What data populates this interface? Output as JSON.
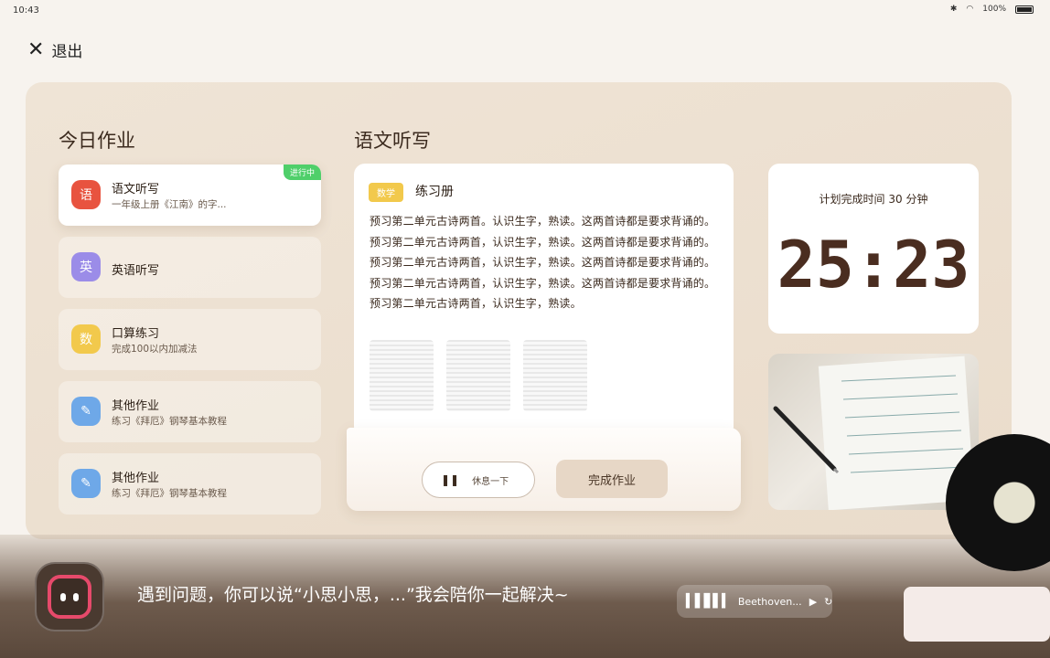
{
  "status": {
    "time": "10:43",
    "battery": "100%"
  },
  "exit": {
    "label": "退出"
  },
  "homework": {
    "title": "今日作业",
    "items": [
      {
        "icon": "语",
        "title": "语文听写",
        "subtitle": "一年级上册《江南》的字...",
        "badge": "进行中",
        "color": "#e8533f"
      },
      {
        "icon": "英",
        "title": "英语听写",
        "subtitle": "",
        "color": "#9b8ce8"
      },
      {
        "icon": "数",
        "title": "口算练习",
        "subtitle": "完成100以内加减法",
        "color": "#f2c94c"
      },
      {
        "icon": "pen-icon",
        "title": "其他作业",
        "subtitle": "练习《拜厄》钢琴基本教程",
        "color": "#6ea8e8"
      },
      {
        "icon": "pen-icon",
        "title": "其他作业",
        "subtitle": "练习《拜厄》钢琴基本教程",
        "color": "#6ea8e8"
      }
    ]
  },
  "task": {
    "title": "语文听写",
    "subject_tag": "数学",
    "book": "练习册",
    "content": "预习第二单元古诗两首。认识生字，熟读。这两首诗都是要求背诵的。预习第二单元古诗两首，认识生字，熟读。这两首诗都是要求背诵的。预习第二单元古诗两首，认识生字，熟读。这两首诗都是要求背诵的。预习第二单元古诗两首，认识生字，熟读。这两首诗都是要求背诵的。预习第二单元古诗两首，认识生字，熟读。",
    "pause_label": "休息一下",
    "finish_label": "完成作业"
  },
  "timer": {
    "label": "计划完成时间 30 分钟",
    "value": "25:23"
  },
  "assistant": {
    "prompt": "遇到问题，你可以说“小思小思，...”我会陪你一起解决~"
  },
  "music": {
    "track": "Beethoven..."
  }
}
